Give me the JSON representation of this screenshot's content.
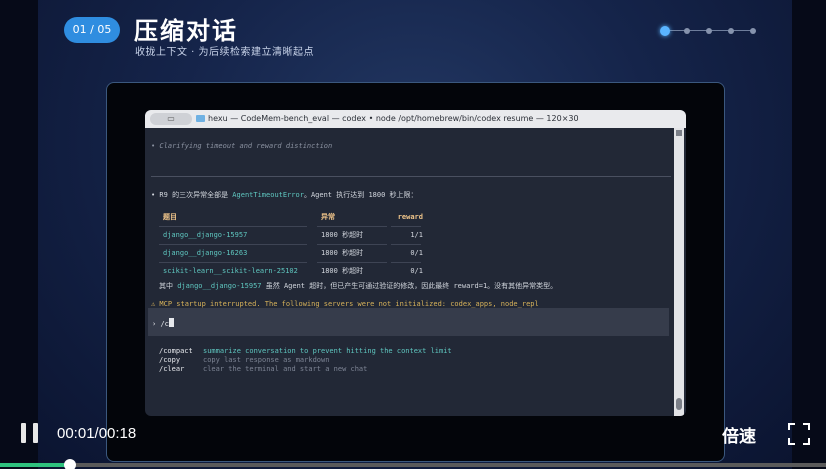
{
  "slide": {
    "badge": "01 / 05",
    "title": "压缩对话",
    "subtitle": "收拢上下文 · 为后续检索建立清晰起点",
    "pager": {
      "total": 5,
      "current": 1
    }
  },
  "terminal": {
    "window_title": "hexu — CodeMem-bench_eval — codex • node /opt/homebrew/bin/codex resume — 120×30",
    "status_line": "• Clarifying timeout and reward distinction",
    "summary_prefix": "• R9 的三次异常全部是 ",
    "summary_error": "AgentTimeoutError",
    "summary_suffix": "。Agent 执行达到 1800 秒上限：",
    "table": {
      "headers": [
        "题目",
        "异常",
        "reward"
      ],
      "rows": [
        [
          "django__django-15957",
          "1800 秒超时",
          "1/1"
        ],
        [
          "django__django-16263",
          "1800 秒超时",
          "0/1"
        ],
        [
          "scikit-learn__scikit-learn-25102",
          "1800 秒超时",
          "0/1"
        ]
      ]
    },
    "note_prefix": "其中 ",
    "note_task": "django__django-15957",
    "note_suffix": " 虽然 Agent 超时，但已产生可通过验证的修改，因此最终 reward=1。没有其他异常类型。",
    "warning": "⚠ MCP startup interrupted. The following servers were not initialized: codex_apps, node_repl",
    "prompt_marker": "›",
    "prompt_input": "/c",
    "commands": [
      {
        "name": "/compact",
        "desc": "summarize conversation to prevent hitting the context limit"
      },
      {
        "name": "/copy",
        "desc": "copy last response as markdown"
      },
      {
        "name": "/clear",
        "desc": "clear the terminal and start a new chat"
      }
    ]
  },
  "player": {
    "time": "00:01/00:18",
    "speed_label": "倍速",
    "progress": 0.085
  },
  "colors": {
    "accent": "#2f8de0",
    "progress": "#2ec27e",
    "terminal_bg": "#222836",
    "highlight": "#5fc7c0",
    "warning": "#d7b25a"
  }
}
